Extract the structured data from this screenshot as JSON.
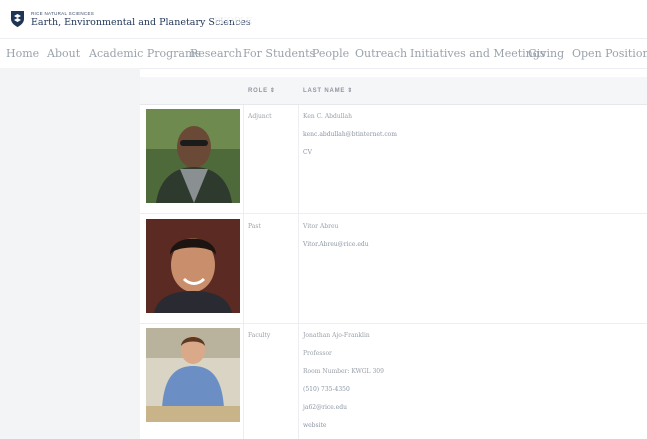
{
  "header": {
    "brand_small": "RICE NATURAL SCIENCES",
    "brand_main": "Earth, Environmental and Planetary Sciences"
  },
  "nav": {
    "items": [
      "Home",
      "About",
      "Academic Programs",
      "Research",
      "For Students",
      "People",
      "Outreach",
      "Initiatives and Meetings",
      "Giving",
      "Open Positions"
    ]
  },
  "table": {
    "headers": {
      "role": "ROLE",
      "last_name": "LAST NAME",
      "sort_icon": "⇕"
    },
    "rows": [
      {
        "role": "Adjunct",
        "lines": [
          "Ken C. Abdullah",
          "kenc.abdullah@btinternet.com",
          "CV"
        ]
      },
      {
        "role": "Past",
        "lines": [
          "Vitor Abreu",
          "Vitor.Abreu@rice.edu"
        ]
      },
      {
        "role": "Faculty",
        "lines": [
          "Jonathan Ajo-Franklin",
          "Professor",
          "Room Number: KWGL 309",
          "(510) 735-4350",
          "ja62@rice.edu",
          "website"
        ]
      }
    ]
  },
  "colors": {
    "brand": "#1f3556",
    "nav_text": "#9aa2ab",
    "panel_bg": "#f3f4f6",
    "header_bg": "#f5f6f8"
  },
  "icons": {
    "logo": "rice-shield-icon",
    "sort": "sort-arrows-icon"
  }
}
